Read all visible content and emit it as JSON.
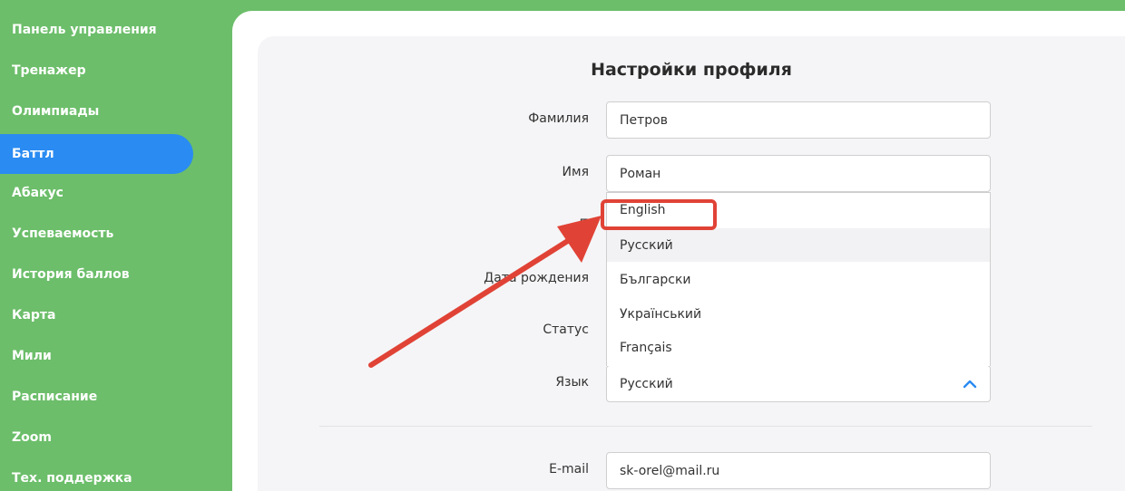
{
  "sidebar": {
    "items": [
      {
        "label": "Панель управления",
        "active": false
      },
      {
        "label": "Тренажер",
        "active": false
      },
      {
        "label": "Олимпиады",
        "active": false
      },
      {
        "label": "Баттл",
        "active": true
      },
      {
        "label": "Абакус",
        "active": false
      },
      {
        "label": "Успеваемость",
        "active": false
      },
      {
        "label": "История баллов",
        "active": false
      },
      {
        "label": "Карта",
        "active": false
      },
      {
        "label": "Мили",
        "active": false
      },
      {
        "label": "Расписание",
        "active": false
      },
      {
        "label": "Zoom",
        "active": false
      },
      {
        "label": "Тех. поддержка",
        "active": false
      }
    ]
  },
  "profile": {
    "title": "Настройки профиля",
    "fields": {
      "last_name": {
        "label": "Фамилия",
        "value": "Петров"
      },
      "first_name": {
        "label": "Имя",
        "value": "Роман"
      },
      "gender": {
        "label": "П"
      },
      "birth_date": {
        "label": "Дата рождения"
      },
      "status": {
        "label": "Статус"
      },
      "language": {
        "label": "Язык",
        "value": "Русский"
      },
      "email": {
        "label": "E-mail",
        "value": "sk-orel@mail.ru"
      }
    },
    "language_options": [
      "English",
      "Русский",
      "Български",
      "Український",
      "Français"
    ]
  },
  "colors": {
    "sidebar_bg": "#6cbe6a",
    "active_item": "#2a8bf2",
    "annotation": "#e04336",
    "chevron": "#2a8bf2"
  }
}
